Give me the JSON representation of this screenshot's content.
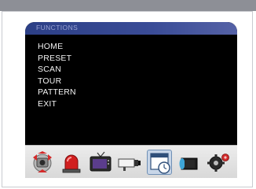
{
  "osd": {
    "title": "FUNCTIONS",
    "menu_items": [
      "HOME",
      "PRESET",
      "SCAN",
      "TOUR",
      "PATTERN",
      "EXIT"
    ]
  },
  "toolbar": {
    "icons": [
      {
        "name": "ptz-camera-icon",
        "selected": false
      },
      {
        "name": "alarm-light-icon",
        "selected": false
      },
      {
        "name": "monitor-icon",
        "selected": false
      },
      {
        "name": "camera-icon",
        "selected": false
      },
      {
        "name": "schedule-clock-icon",
        "selected": true
      },
      {
        "name": "record-tape-icon",
        "selected": false
      },
      {
        "name": "settings-gear-icon",
        "selected": false
      }
    ]
  },
  "colors": {
    "title_bar": "#2c3f86",
    "menu_text": "#f2f2f2",
    "osd_background": "#000000"
  }
}
